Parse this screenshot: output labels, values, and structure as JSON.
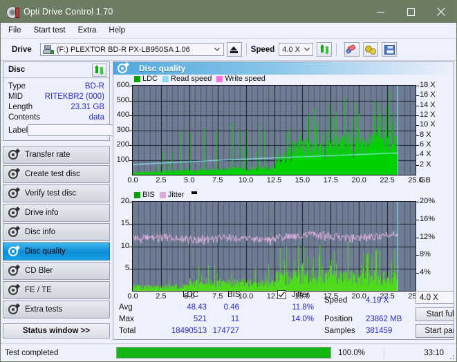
{
  "window": {
    "title": "Opti Drive Control 1.70",
    "icon": "disc-icon",
    "controls": {
      "minimize": "minimize-icon",
      "maximize": "maximize-icon",
      "close": "close-icon"
    }
  },
  "menu": {
    "items": [
      "File",
      "Start test",
      "Extra",
      "Help"
    ]
  },
  "toolbar": {
    "drive_label": "Drive",
    "drive_value": "(F:)   PLEXTOR BD-R  PX-LB950SA 1.06",
    "eject_icon": "eject-icon",
    "speed_label": "Speed",
    "speed_value": "4.0 X",
    "refresh_icon": "refresh-icon",
    "eraser_icon": "eraser-icon",
    "gears_icon": "gears-icon",
    "save_icon": "save-icon"
  },
  "disc_panel": {
    "title": "Disc",
    "refresh_icon": "refresh-icon",
    "rows": [
      {
        "key": "Type",
        "value": "BD-R"
      },
      {
        "key": "MID",
        "value": "RITEKBR2 (000)"
      },
      {
        "key": "Length",
        "value": "23.31 GB"
      },
      {
        "key": "Contents",
        "value": "data"
      }
    ],
    "label_key": "Label",
    "label_value": "",
    "label_placeholder": "",
    "label_button_icon": "cd-icon"
  },
  "sidebar": {
    "items": [
      {
        "label": "Transfer rate",
        "icon": "disc-test-icon",
        "selected": false
      },
      {
        "label": "Create test disc",
        "icon": "disc-test-icon",
        "selected": false
      },
      {
        "label": "Verify test disc",
        "icon": "disc-test-icon",
        "selected": false
      },
      {
        "label": "Drive info",
        "icon": "disc-test-icon",
        "selected": false
      },
      {
        "label": "Disc info",
        "icon": "disc-test-icon",
        "selected": false
      },
      {
        "label": "Disc quality",
        "icon": "disc-test-icon",
        "selected": true
      },
      {
        "label": "CD Bler",
        "icon": "disc-test-icon",
        "selected": false
      },
      {
        "label": "FE / TE",
        "icon": "disc-test-icon",
        "selected": false
      },
      {
        "label": "Extra tests",
        "icon": "disc-test-icon",
        "selected": false
      }
    ],
    "status_window_button": "Status window >>"
  },
  "panel": {
    "title": "Disc quality",
    "icon": "disc-test-icon"
  },
  "stats": {
    "col_headers": [
      "LDC",
      "BIS"
    ],
    "jitter_label": "Jitter",
    "jitter_checked": true,
    "rows": [
      {
        "name": "Avg",
        "ldc": "48.43",
        "bis": "0.46",
        "jitter": "11.8%"
      },
      {
        "name": "Max",
        "ldc": "521",
        "bis": "11",
        "jitter": "14.0%"
      },
      {
        "name": "Total",
        "ldc": "18490513",
        "bis": "174727",
        "jitter": ""
      }
    ],
    "speed_label": "Speed",
    "speed_value": "4.19 X",
    "position_label": "Position",
    "position_value": "23862 MB",
    "samples_label": "Samples",
    "samples_value": "381459",
    "speed_select": "4.0 X",
    "start_full": "Start full",
    "start_part": "Start part"
  },
  "statusbar": {
    "text": "Test completed",
    "percent_label": "100.0%",
    "progress": 100,
    "time": "33:10"
  },
  "colors": {
    "titlebar": "#6b7d62",
    "accent_blue": "#2a2ad1",
    "plot_bg": "#6f7d94",
    "ldc_green": "#00d200",
    "bis_green": "#4ddb1b",
    "read_speed": "#8fe3f7",
    "write_speed": "#ff7fe0",
    "jitter_pink": "#e7b4e0",
    "progress_green": "#12b512",
    "selection": "#1aa4e8"
  },
  "chart_data": [
    {
      "type": "area",
      "name": "ldc-chart",
      "title": "",
      "xlabel": "GB",
      "ylabel": "",
      "xlim": [
        0.0,
        25.0
      ],
      "xticks": [
        "0.0",
        "2.5",
        "5.0",
        "7.5",
        "10.0",
        "12.5",
        "15.0",
        "17.5",
        "20.0",
        "22.5",
        "25.0"
      ],
      "left_axis": {
        "label": "LDC",
        "ylim": [
          0,
          600
        ],
        "yticks": [
          100,
          200,
          300,
          400,
          500,
          600
        ]
      },
      "right_axis": {
        "label": "Speed",
        "ylim": [
          0,
          18
        ],
        "yticks": [
          "2 X",
          "4 X",
          "6 X",
          "8 X",
          "10 X",
          "12 X",
          "14 X",
          "16 X",
          "18 X"
        ]
      },
      "legend": [
        {
          "label": "LDC",
          "color": "#00a000"
        },
        {
          "label": "Read speed",
          "color": "#8fd9f2"
        },
        {
          "label": "Write speed",
          "color": "#ff6fe0"
        }
      ],
      "grid": true,
      "data_end_gb": 23.4,
      "noise_step_gb": 12.6,
      "series": [
        {
          "name": "LDC",
          "kind": "vertical-bars",
          "color": "#00d200",
          "baseline_before_step": 55,
          "baseline_after_step": 170,
          "spike_max": 521,
          "comment": "dense per-sample vertical bars; low region 0-12.6GB avg ~45 with sparse spikes to 300-350; after 12.6GB body rises to ~180-260 with spikes to 400-520"
        },
        {
          "name": "Read speed",
          "kind": "line",
          "color": "#8fe3f7",
          "start_x": 2.0,
          "end_x": 14.4,
          "comment": "monotonically rising CAV read-speed curve from ~2.0X at 0GB to ~4.4X at 23.4GB, then vertical drop marker at end"
        }
      ]
    },
    {
      "type": "area",
      "name": "bis-jitter-chart",
      "title": "",
      "xlabel": "GB",
      "ylabel": "",
      "xlim": [
        0.0,
        25.0
      ],
      "xticks": [
        "0.0",
        "2.5",
        "5.0",
        "7.5",
        "10.0",
        "12.5",
        "15.0",
        "17.5",
        "20.0",
        "22.5",
        "25.0"
      ],
      "left_axis": {
        "label": "BIS",
        "ylim": [
          0,
          20
        ],
        "yticks": [
          5,
          10,
          15,
          20
        ]
      },
      "right_axis": {
        "label": "Jitter",
        "ylim": [
          0,
          20
        ],
        "yticks": [
          "4%",
          "8%",
          "12%",
          "16%",
          "20%"
        ]
      },
      "legend": [
        {
          "label": "BIS",
          "color": "#00a000"
        },
        {
          "label": "Jitter",
          "color": "#e0a8d8"
        }
      ],
      "grid": true,
      "data_end_gb": 23.4,
      "noise_step_gb": 12.6,
      "series": [
        {
          "name": "BIS",
          "kind": "vertical-bars",
          "color": "#4ddb1b",
          "baseline_before_step": 1.6,
          "baseline_after_step": 3.6,
          "spike_max": 11,
          "comment": "dense bars; 0-5GB body ~1.5 max ~3; 5-12.6GB body ~2.5 spikes to 6; after 12.6GB body ~4 spikes to 9-11"
        },
        {
          "name": "Jitter",
          "kind": "line",
          "color": "#e7b4e0",
          "mean_percent": 11.8,
          "max_percent": 14.0,
          "comment": "noisy pink trace oscillating around 11.8% (value ~11.8 on 0-20 left scale) across whole disc"
        }
      ]
    }
  ]
}
